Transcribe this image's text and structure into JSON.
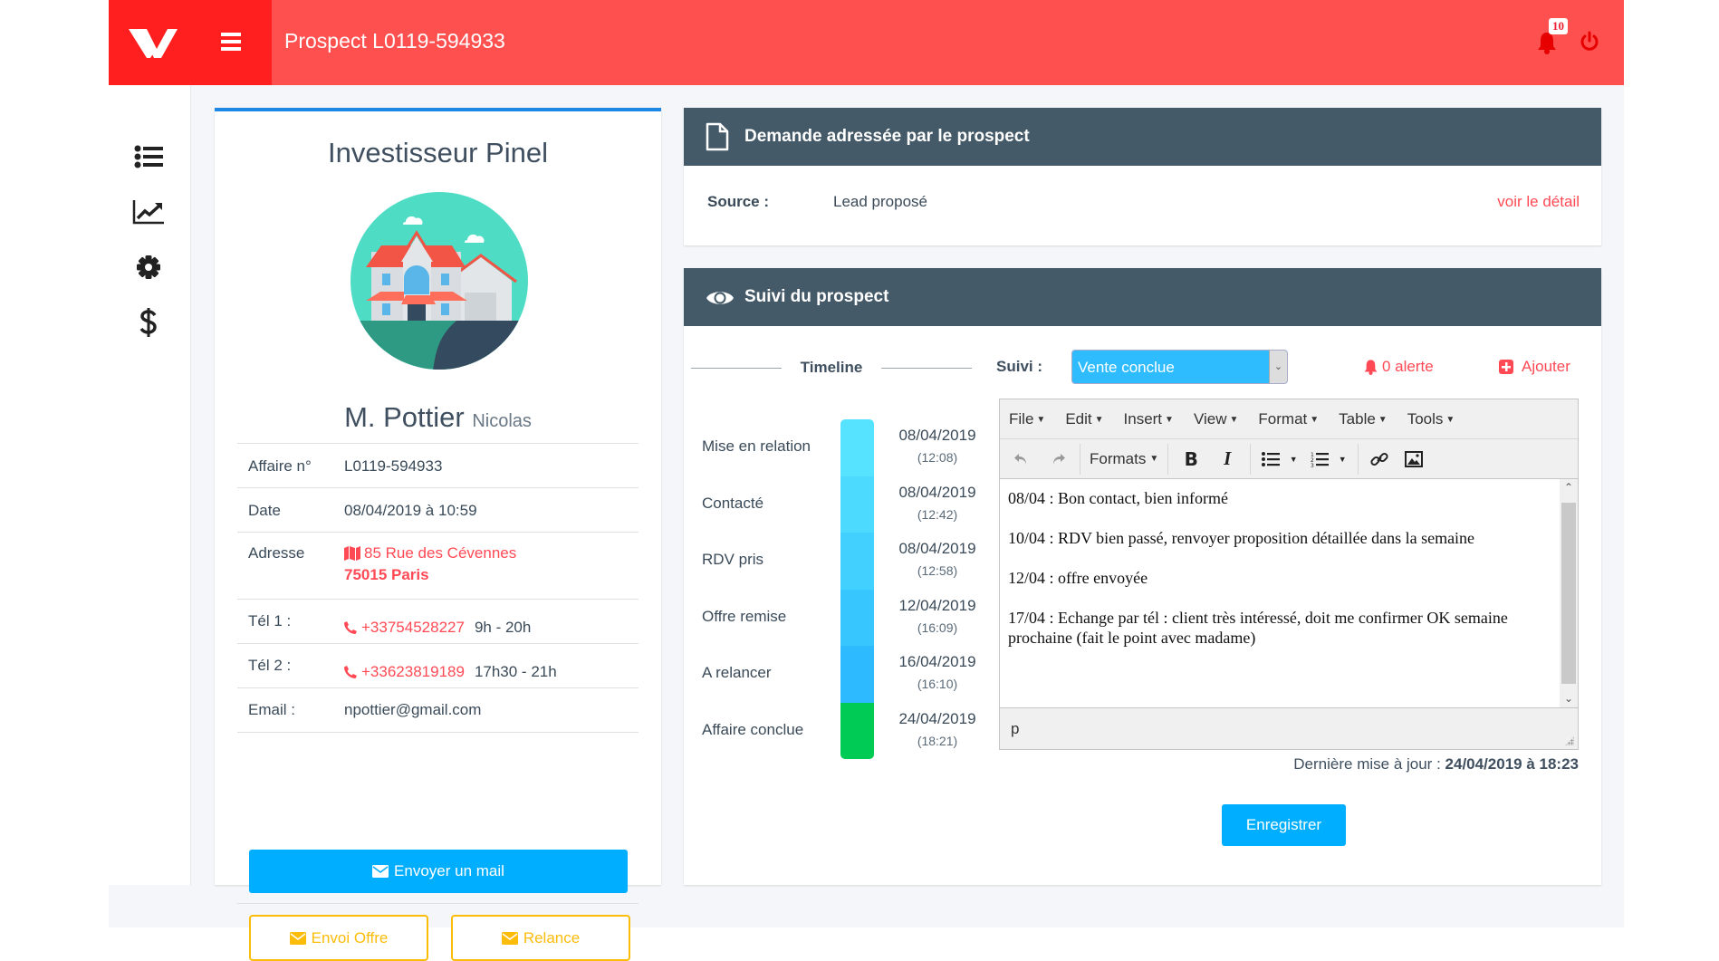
{
  "topbar": {
    "title": "Prospect L0119-594933",
    "notification_count": "10",
    "icons": [
      "logo",
      "hamburger-icon",
      "bell-icon",
      "power-icon"
    ]
  },
  "sidebar": {
    "items": [
      {
        "icon": "list-icon"
      },
      {
        "icon": "chart-line-icon"
      },
      {
        "icon": "gear-icon"
      },
      {
        "icon": "dollar-icon"
      }
    ]
  },
  "profile": {
    "title": "Investisseur Pinel",
    "last_name": "M. Pottier",
    "first_name": "Nicolas",
    "rows": [
      {
        "label": "Affaire n°",
        "value": "L0119-594933"
      },
      {
        "label": "Date",
        "value": "08/04/2019 à 10:59"
      },
      {
        "label": "Adresse",
        "street": "85 Rue des Cévennes",
        "city": "75015 Paris"
      },
      {
        "label": "Tél 1 :",
        "phone": "+33754528227",
        "hours": "9h - 20h"
      },
      {
        "label": "Tél 2 :",
        "phone": "+33623819189",
        "hours": "17h30 - 21h"
      },
      {
        "label": "Email :",
        "value": "npottier@gmail.com"
      }
    ],
    "send_mail_label": "Envoyer un mail",
    "offer_label": "Envoi Offre",
    "reminder_label": "Relance"
  },
  "request_panel": {
    "title": "Demande adressée par le prospect",
    "source_label": "Source :",
    "source_value": "Lead proposé",
    "detail_link": "voir le détail"
  },
  "followup_panel": {
    "title": "Suivi du prospect",
    "timeline_title": "Timeline",
    "timeline": [
      {
        "label": "Mise en relation",
        "date": "08/04/2019",
        "time": "(12:08)",
        "color": "#55e3ff"
      },
      {
        "label": "Contacté",
        "date": "08/04/2019",
        "time": "(12:42)",
        "color": "#4cdaff"
      },
      {
        "label": "RDV pris",
        "date": "08/04/2019",
        "time": "(12:58)",
        "color": "#42d0ff"
      },
      {
        "label": "Offre remise",
        "date": "12/04/2019",
        "time": "(16:09)",
        "color": "#38c6ff"
      },
      {
        "label": "A relancer",
        "date": "16/04/2019",
        "time": "(16:10)",
        "color": "#2ebaff"
      },
      {
        "label": "Affaire conclue",
        "date": "24/04/2019",
        "time": "(18:21)",
        "color": "#00cc55"
      }
    ],
    "suivi_label": "Suivi :",
    "suivi_value": "Vente conclue",
    "alert_label": "0 alerte",
    "add_label": "Ajouter",
    "editor": {
      "menus": [
        "File",
        "Edit",
        "Insert",
        "View",
        "Format",
        "Table",
        "Tools"
      ],
      "formats_label": "Formats",
      "notes": [
        "08/04 : Bon contact, bien informé",
        "10/04 : RDV bien passé, renvoyer proposition détaillée dans la semaine",
        "12/04 : offre envoyée",
        "17/04 : Echange par tél : client très intéressé, doit me confirmer OK semaine prochaine (fait le point avec madame)"
      ],
      "status_path": "p"
    },
    "updated_label": "Dernière mise à jour :",
    "updated_value": "24/04/2019 à 18:23",
    "save_label": "Enregistrer"
  },
  "colors": {
    "topbar": "#ff5050",
    "logo_bg": "#ff1f1f",
    "accent_blue": "#00aeff",
    "panel_header": "#455a68",
    "warning": "#fcbc0a",
    "link_red": "#ff4a55"
  }
}
